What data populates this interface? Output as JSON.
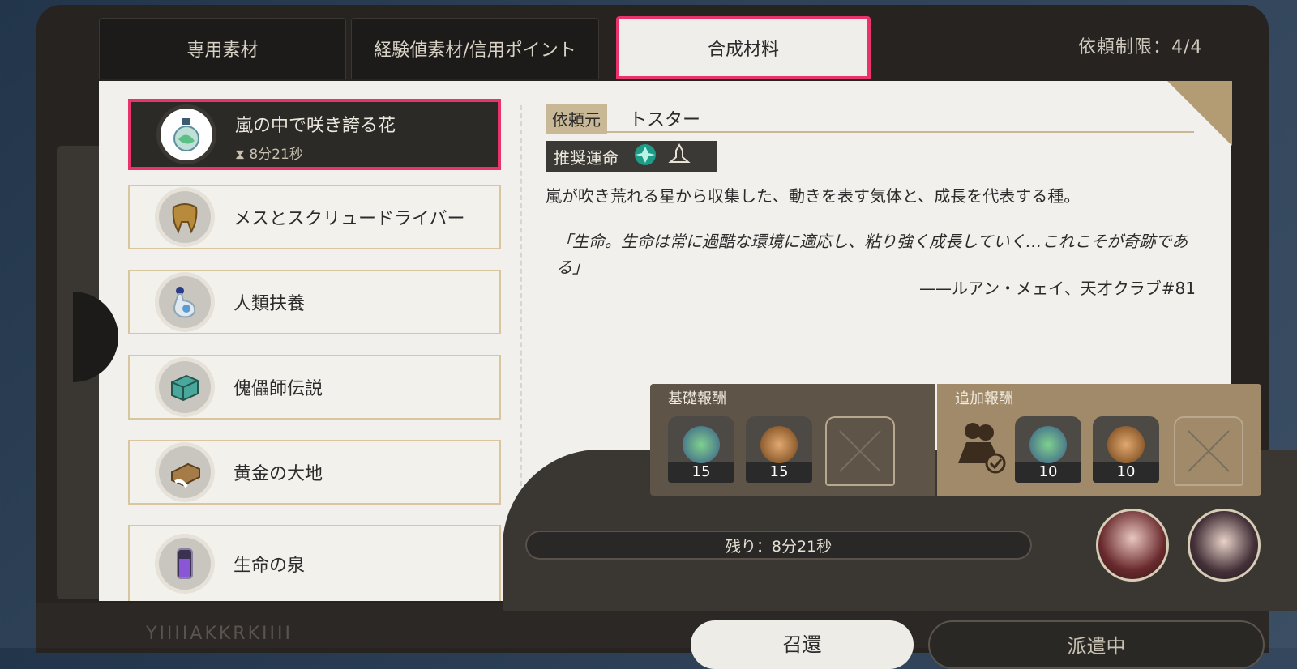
{
  "tabs": [
    "専用素材",
    "経験値素材/信用ポイント",
    "合成材料"
  ],
  "request_limit": "依頼制限：4/4",
  "list": {
    "selected_time": "8分21秒",
    "items": [
      {
        "label": "嵐の中で咲き誇る花",
        "icon": "green-flask-icon"
      },
      {
        "label": "メスとスクリュードライバー",
        "icon": "golden-tooth-icon"
      },
      {
        "label": "人類扶養",
        "icon": "glass-bottle-icon"
      },
      {
        "label": "傀儡師伝説",
        "icon": "jade-box-icon"
      },
      {
        "label": "黄金の大地",
        "icon": "gold-bricks-icon"
      },
      {
        "label": "生命の泉",
        "icon": "purple-vial-icon"
      }
    ]
  },
  "detail": {
    "client_label": "依頼元",
    "client_name": "トスター",
    "path_label": "推奨運命",
    "description": "嵐が吹き荒れる星から収集した、動きを表す気体と、成長を代表する種。",
    "quote": "「生命。生命は常に過酷な環境に適応し、粘り強く成長していく…これこそが奇跡である」",
    "quote_author": "——ルアン・メェイ、天才クラブ#81"
  },
  "rewards": {
    "basic_label": "基礎報酬",
    "extra_label": "追加報酬",
    "basic": [
      {
        "icon": "green-flask-icon",
        "count": "15"
      },
      {
        "icon": "bread-icon",
        "count": "15"
      }
    ],
    "extra": [
      {
        "icon": "green-flask-icon",
        "count": "10"
      },
      {
        "icon": "bread-icon",
        "count": "10"
      }
    ]
  },
  "timer": "残り：8分21秒",
  "buttons": {
    "recall": "召還",
    "dispatching": "派遣中"
  },
  "bottom_deco": "YIIIIAKKRKIIII",
  "colors": {
    "highlight": "#e8336d",
    "gold": "#c9b896",
    "panel": "#f1f0ec",
    "dark": "#262320"
  }
}
